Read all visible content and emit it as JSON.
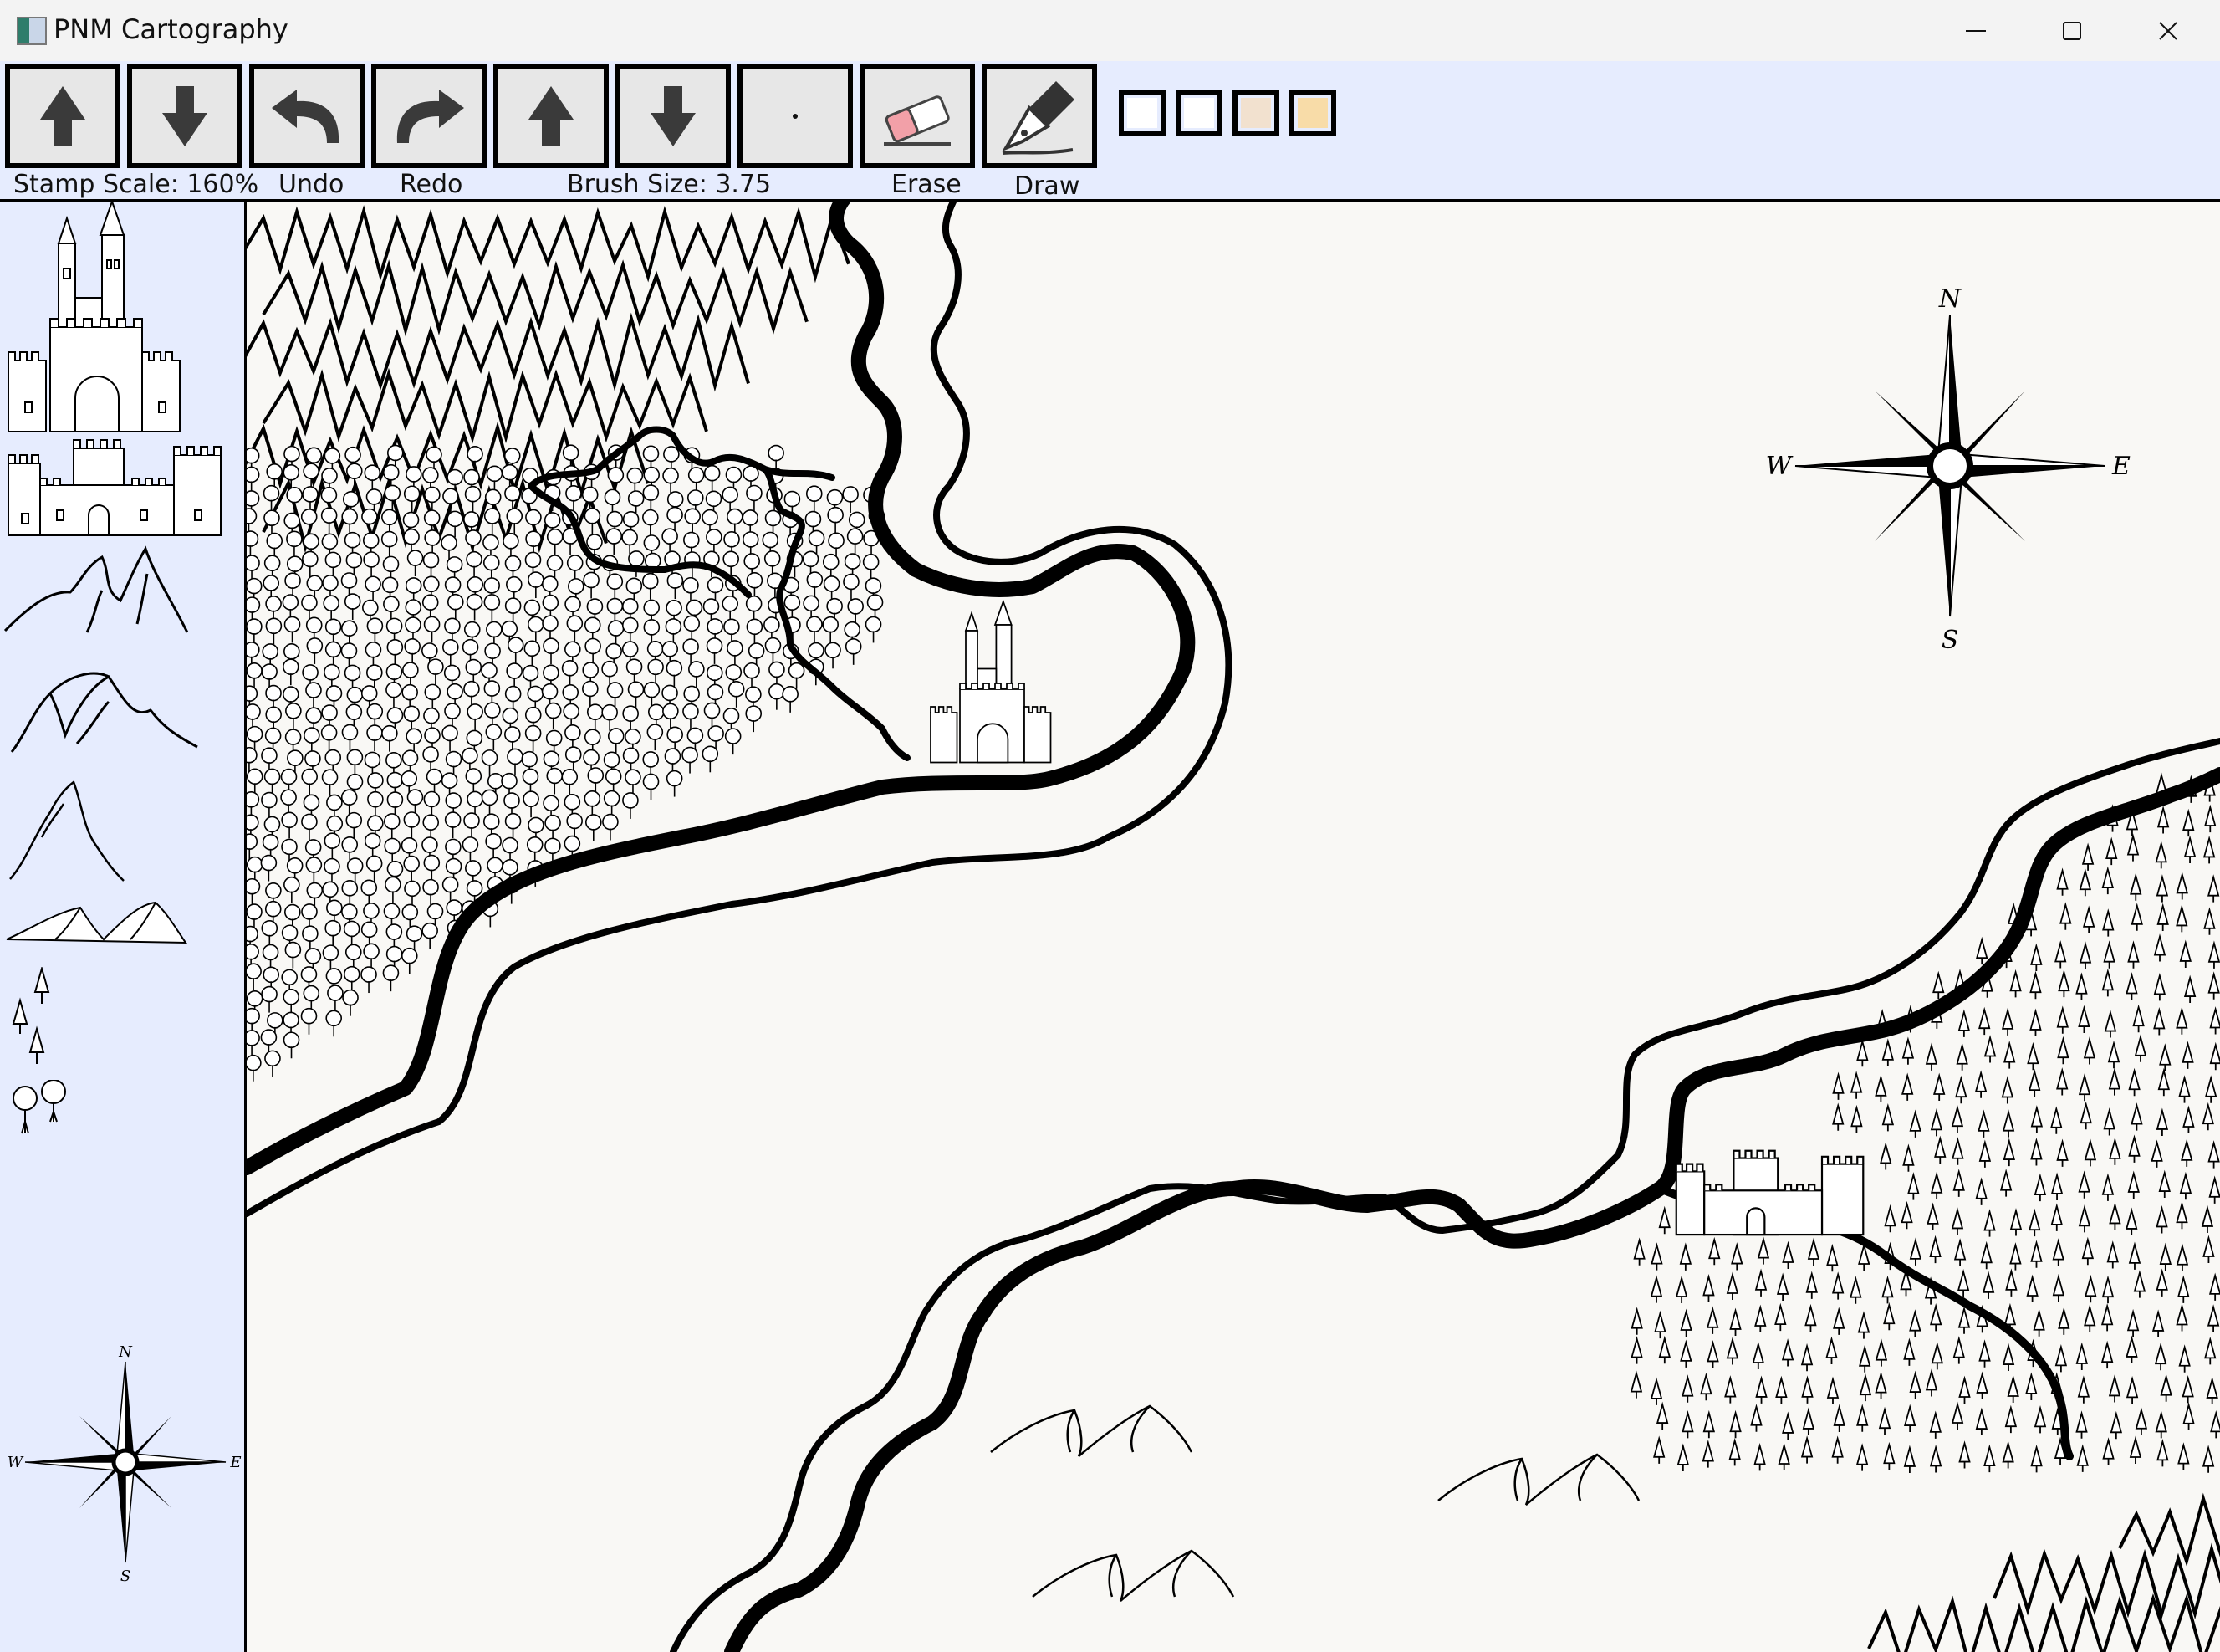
{
  "window": {
    "title": "PNM Cartography",
    "controls": [
      "minimize",
      "maximize",
      "close"
    ]
  },
  "toolbar": {
    "stamp_scale_label": "Stamp Scale: 160%",
    "undo_label": "Undo",
    "redo_label": "Redo",
    "brush_size_label": "Brush Size: 3.75",
    "erase_label": "Erase",
    "draw_label": "Draw",
    "buttons": [
      {
        "name": "stamp-scale-up",
        "icon": "arrow-up-icon"
      },
      {
        "name": "stamp-scale-down",
        "icon": "arrow-down-icon"
      },
      {
        "name": "undo",
        "icon": "undo-arrow-icon"
      },
      {
        "name": "redo",
        "icon": "redo-arrow-icon"
      },
      {
        "name": "brush-size-up",
        "icon": "arrow-up-icon"
      },
      {
        "name": "brush-size-down",
        "icon": "arrow-down-icon"
      },
      {
        "name": "brush-preview",
        "icon": "dot-icon"
      },
      {
        "name": "erase",
        "icon": "eraser-icon"
      },
      {
        "name": "draw",
        "icon": "pen-nib-icon"
      }
    ],
    "swatches": [
      "#ffffff",
      "#ffffff",
      "#f2e1cf",
      "#f8dca8"
    ]
  },
  "palette": {
    "items": [
      "castle-tall",
      "castle-wide",
      "mountains-jagged",
      "mountains-peaks",
      "mountain-single",
      "dunes",
      "pine-trees",
      "deciduous-trees",
      "compass-rose"
    ]
  },
  "compass": {
    "n": "N",
    "e": "E",
    "s": "S",
    "w": "W"
  },
  "colors": {
    "toolbar_bg": "#e6ecfe",
    "canvas_bg": "#f9f8f5",
    "ink": "#000000"
  }
}
